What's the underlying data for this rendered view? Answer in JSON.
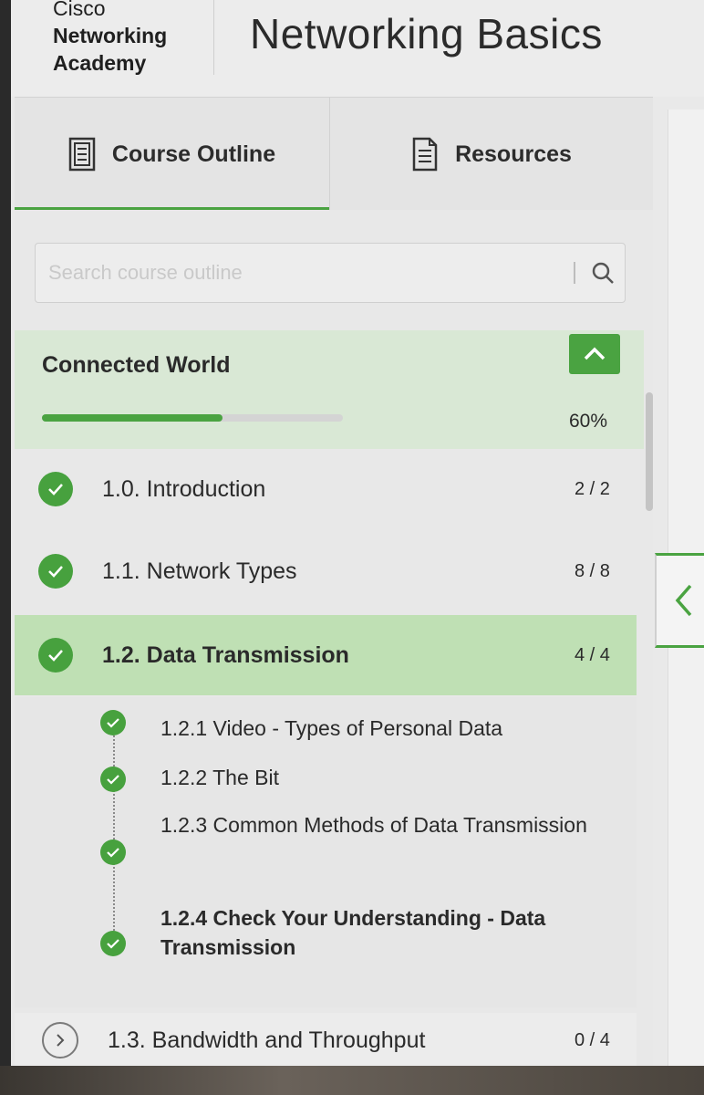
{
  "header": {
    "logo_line1": "Cisco",
    "logo_line2": "Networking",
    "logo_line3": "Academy",
    "course_title": "Networking Basics"
  },
  "tabs": [
    {
      "label": "Course Outline",
      "icon": "outline-icon",
      "active": true
    },
    {
      "label": "Resources",
      "icon": "document-icon",
      "active": false
    }
  ],
  "search": {
    "placeholder": "Search course outline",
    "value": ""
  },
  "module": {
    "title": "Connected World",
    "progress_label": "60%",
    "progress": 0.6,
    "expanded": true
  },
  "topics": [
    {
      "label": "1.0. Introduction",
      "count": "2 / 2",
      "completed": true
    },
    {
      "label": "1.1. Network Types",
      "count": "8 / 8",
      "completed": true
    },
    {
      "label": "1.2. Data Transmission",
      "count": "4 / 4",
      "completed": true,
      "active": true
    }
  ],
  "subtopics": [
    {
      "label": "1.2.1 Video - Types of Personal Data",
      "completed": true
    },
    {
      "label": "1.2.2 The Bit",
      "completed": true
    },
    {
      "label": "1.2.3 Common Methods of Data Transmission",
      "completed": true
    },
    {
      "label": "1.2.4 Check Your Understanding - Data Transmission",
      "completed": true,
      "current": true
    }
  ],
  "next_topic": {
    "label": "1.3. Bandwidth and Throughput",
    "count": "0 / 4"
  },
  "colors": {
    "accent": "#4aa341",
    "active_row": "#bfe0b4",
    "module_header": "#d9e8d5"
  },
  "icons": {
    "search": "search-icon",
    "collapse": "chevron-up-icon",
    "check": "check-icon",
    "side_toggle": "chevron-left-icon",
    "next": "chevron-right-icon"
  }
}
